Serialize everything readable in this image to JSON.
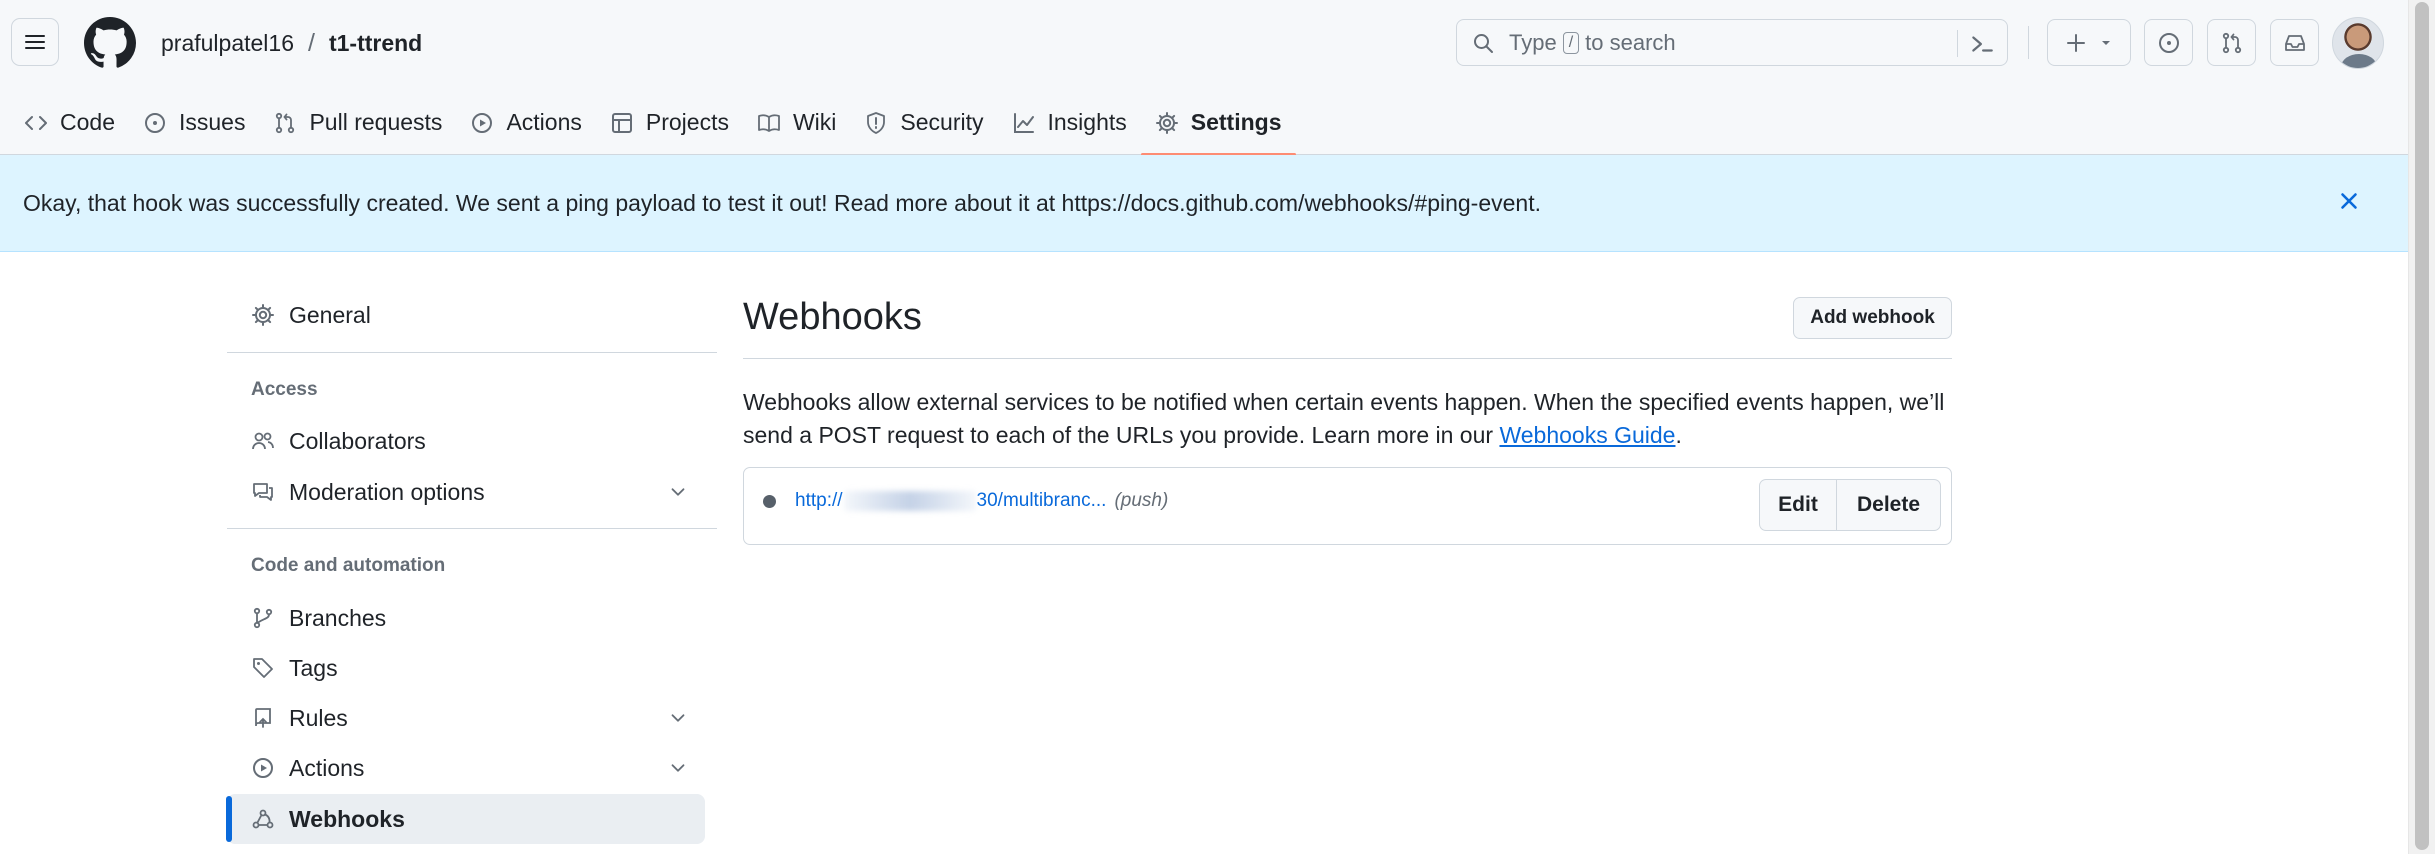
{
  "header": {
    "owner": "prafulpatel16",
    "separator": "/",
    "repo": "t1-ttrend",
    "search": {
      "prefix": "Type",
      "key": "/",
      "suffix": "to search"
    }
  },
  "nav": {
    "tabs": [
      {
        "label": "Code",
        "icon": "code-icon"
      },
      {
        "label": "Issues",
        "icon": "issue-opened-icon"
      },
      {
        "label": "Pull requests",
        "icon": "git-pull-request-icon"
      },
      {
        "label": "Actions",
        "icon": "play-icon"
      },
      {
        "label": "Projects",
        "icon": "table-icon"
      },
      {
        "label": "Wiki",
        "icon": "book-icon"
      },
      {
        "label": "Security",
        "icon": "shield-icon"
      },
      {
        "label": "Insights",
        "icon": "graph-icon"
      },
      {
        "label": "Settings",
        "icon": "gear-icon"
      }
    ],
    "selected": "Settings"
  },
  "flash": {
    "message": "Okay, that hook was successfully created. We sent a ping payload to test it out! Read more about it at https://docs.github.com/webhooks/#ping-event."
  },
  "sidebar": {
    "general": "General",
    "access_heading": "Access",
    "collaborators": "Collaborators",
    "moderation": "Moderation options",
    "code_heading": "Code and automation",
    "branches": "Branches",
    "tags": "Tags",
    "rules": "Rules",
    "actions": "Actions",
    "webhooks": "Webhooks"
  },
  "main": {
    "title": "Webhooks",
    "add_button": "Add webhook",
    "description_before": "Webhooks allow external services to be notified when certain events happen. When the specified events happen, we’ll send a POST request to each of the URLs you provide. Learn more in our ",
    "description_link": "Webhooks Guide",
    "description_after": ".",
    "hook": {
      "url_start": "http://",
      "url_end": "30/multibranc...",
      "events": "(push)",
      "edit_label": "Edit",
      "delete_label": "Delete",
      "status_color": "#57606a"
    }
  },
  "colors": {
    "accent": "#0969da",
    "selected_underline": "#fd8c73",
    "flash_bg": "#ddf4ff"
  }
}
